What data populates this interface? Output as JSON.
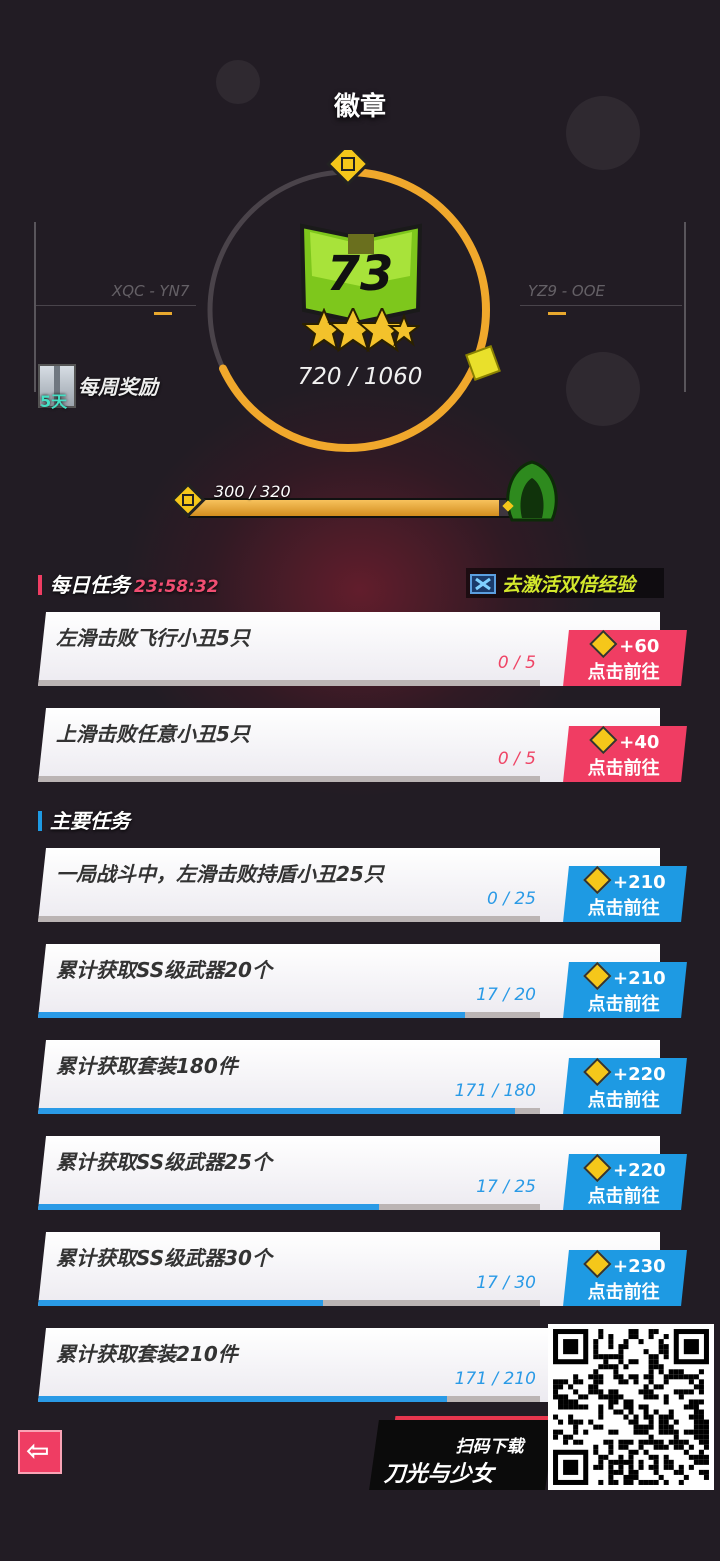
{
  "header": {
    "title": "徽章"
  },
  "badge": {
    "level": "73",
    "stars": 3,
    "xp_text": "720 / 1060",
    "ring_progress": 0.68
  },
  "side_codes": {
    "left": "XQC - YN7",
    "right": "YZ9 - OOE"
  },
  "weekly_reward": {
    "label": "每周奖励",
    "days": "5天"
  },
  "milestone": {
    "progress_text": "300 / 320",
    "progress": 0.9375
  },
  "daily": {
    "title": "每日任务",
    "timer": "23:58:32",
    "double_exp_label": "去激活双倍经验",
    "tasks": [
      {
        "name": "左滑击败飞行小丑5只",
        "progress_text": "0 / 5",
        "progress": 0,
        "reward": "+60",
        "go": "点击前往"
      },
      {
        "name": "上滑击败任意小丑5只",
        "progress_text": "0 / 5",
        "progress": 0,
        "reward": "+40",
        "go": "点击前往"
      }
    ]
  },
  "main": {
    "title": "主要任务",
    "tasks": [
      {
        "name": "一局战斗中，左滑击败持盾小丑25只",
        "progress_text": "0 / 25",
        "progress": 0,
        "reward": "+210",
        "go": "点击前往"
      },
      {
        "name": "累计获取SS级武器20个",
        "progress_text": "17 / 20",
        "progress": 0.85,
        "reward": "+210",
        "go": "点击前往"
      },
      {
        "name": "累计获取套装180件",
        "progress_text": "171 / 180",
        "progress": 0.95,
        "reward": "+220",
        "go": "点击前往"
      },
      {
        "name": "累计获取SS级武器25个",
        "progress_text": "17 / 25",
        "progress": 0.68,
        "reward": "+220",
        "go": "点击前往"
      },
      {
        "name": "累计获取SS级武器30个",
        "progress_text": "17 / 30",
        "progress": 0.567,
        "reward": "+230",
        "go": "点击前往"
      },
      {
        "name": "累计获取套装210件",
        "progress_text": "171 / 210",
        "progress": 0.814
      }
    ]
  },
  "promo": {
    "line1": "扫码下载",
    "line2": "刀光与少女"
  },
  "colors": {
    "accent_red": "#f03d63",
    "accent_blue": "#1e9ae3",
    "gold": "#f0a82c"
  }
}
